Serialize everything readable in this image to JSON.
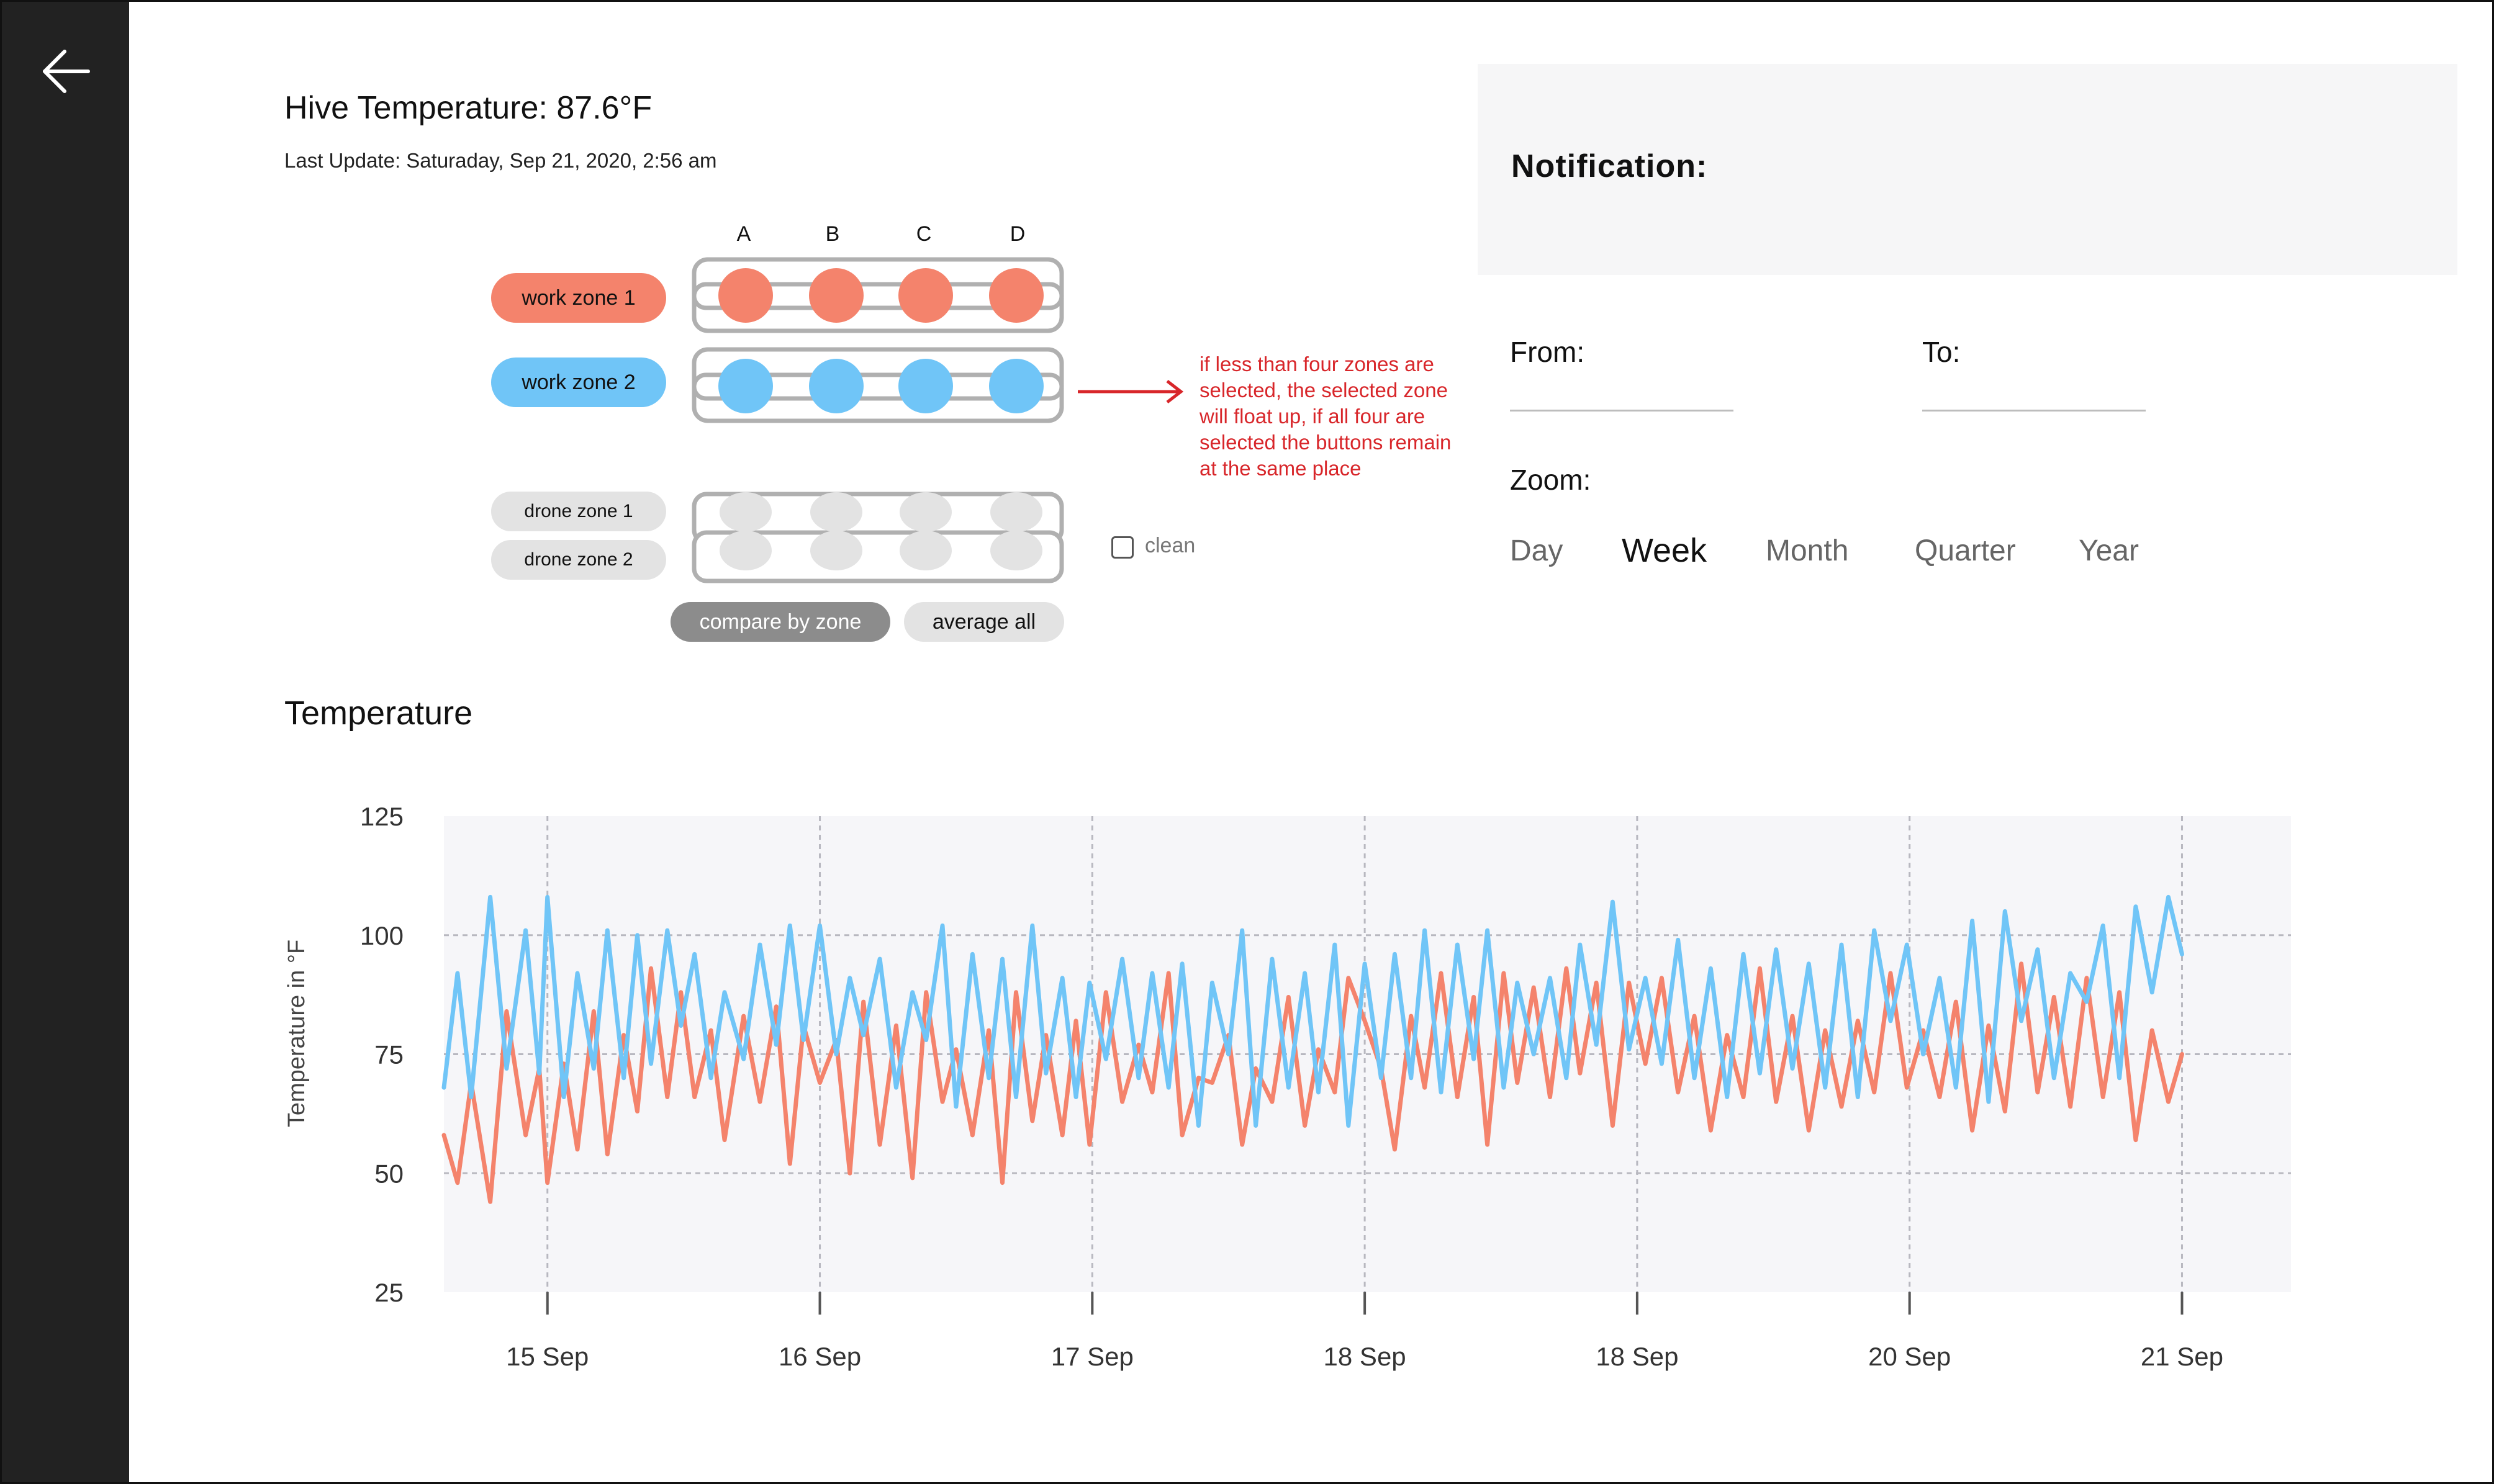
{
  "header": {
    "hive_temperature": "Hive Temperature: 87.6°F",
    "last_update": "Last Update: Saturaday, Sep 21, 2020, 2:56 am"
  },
  "zones": {
    "columns": [
      "A",
      "B",
      "C",
      "D"
    ],
    "work_zone_1": "work zone 1",
    "work_zone_2": "work zone 2",
    "drone_zone_1": "drone zone 1",
    "drone_zone_2": "drone zone 2",
    "compare_button": "compare by zone",
    "average_button": "average all",
    "clean_label": "clean",
    "annotation": "if less than four zones are selected, the selected zone will float up, if all four are selected the buttons remain at the same place"
  },
  "notification": {
    "title": "Notification:"
  },
  "filters": {
    "from_label": "From:",
    "to_label": "To:",
    "zoom_label": "Zoom:",
    "zoom_options": [
      "Day",
      "Week",
      "Month",
      "Quarter",
      "Year"
    ],
    "zoom_selected": "Week"
  },
  "chart_section": {
    "title": "Temperature"
  },
  "colors": {
    "work_zone_1": "#f4836c",
    "work_zone_2": "#70c5f7",
    "drone": "#e3e3e3",
    "annotation": "#d8262a",
    "sidebar": "#222222",
    "plot_background": "#f6f6f9"
  },
  "icons": {
    "back": "arrow-left-icon"
  },
  "chart_data": {
    "type": "line",
    "ylabel": "Temperature in °F",
    "ylim": [
      25,
      125
    ],
    "yticks": [
      25,
      50,
      75,
      100,
      125
    ],
    "x_tick_labels": [
      "15 Sep",
      "16 Sep",
      "17 Sep",
      "18 Sep",
      "18 Sep",
      "20 Sep",
      "21 Sep"
    ],
    "xlim": [
      14.62,
      21.4
    ],
    "x_tick_positions": [
      15,
      16,
      17,
      18,
      19,
      20,
      21
    ],
    "grid": true,
    "series": [
      {
        "color": "#f4836c",
        "x": [
          14.62,
          14.67,
          14.72,
          14.79,
          14.85,
          14.92,
          14.97,
          15.0,
          15.06,
          15.11,
          15.17,
          15.22,
          15.28,
          15.33,
          15.38,
          15.44,
          15.49,
          15.54,
          15.6,
          15.65,
          15.72,
          15.78,
          15.84,
          15.89,
          15.94,
          16.0,
          16.06,
          16.11,
          16.16,
          16.22,
          16.28,
          16.34,
          16.39,
          16.45,
          16.5,
          16.56,
          16.62,
          16.67,
          16.72,
          16.78,
          16.83,
          16.89,
          16.94,
          16.99,
          17.05,
          17.11,
          17.17,
          17.22,
          17.28,
          17.33,
          17.39,
          17.44,
          17.5,
          17.55,
          17.6,
          17.66,
          17.72,
          17.78,
          17.83,
          17.89,
          17.94,
          18.0,
          18.06,
          18.11,
          18.17,
          18.22,
          18.28,
          18.34,
          18.4,
          18.45,
          18.51,
          18.56,
          18.62,
          18.68,
          18.74,
          18.79,
          18.85,
          18.91,
          18.97,
          19.03,
          19.09,
          19.15,
          19.21,
          19.27,
          19.33,
          19.39,
          19.45,
          19.51,
          19.57,
          19.63,
          19.69,
          19.75,
          19.81,
          19.87,
          19.93,
          19.99,
          20.05,
          20.11,
          20.17,
          20.23,
          20.29,
          20.35,
          20.41,
          20.47,
          20.53,
          20.59,
          20.65,
          20.71,
          20.77,
          20.83,
          20.89,
          20.95,
          21.0
        ],
        "values": [
          58,
          48,
          69,
          44,
          84,
          58,
          72,
          48,
          73,
          55,
          84,
          54,
          79,
          63,
          93,
          66,
          88,
          66,
          80,
          57,
          83,
          65,
          85,
          52,
          81,
          69,
          78,
          50,
          86,
          56,
          81,
          49,
          88,
          65,
          76,
          58,
          80,
          48,
          88,
          61,
          79,
          58,
          82,
          56,
          88,
          65,
          77,
          67,
          92,
          58,
          70,
          69,
          79,
          56,
          72,
          65,
          87,
          60,
          76,
          67,
          91,
          82,
          72,
          55,
          83,
          68,
          92,
          66,
          87,
          56,
          92,
          69,
          89,
          66,
          93,
          71,
          90,
          60,
          90,
          73,
          91,
          67,
          83,
          59,
          79,
          66,
          93,
          65,
          83,
          59,
          80,
          64,
          82,
          67,
          92,
          68,
          80,
          66,
          86,
          59,
          81,
          63,
          94,
          67,
          87,
          64,
          91,
          66,
          88,
          57,
          80,
          65,
          75
        ]
      },
      {
        "color": "#70c5f7",
        "x": [
          14.62,
          14.67,
          14.72,
          14.79,
          14.85,
          14.92,
          14.97,
          15.0,
          15.06,
          15.11,
          15.17,
          15.22,
          15.28,
          15.33,
          15.38,
          15.44,
          15.49,
          15.54,
          15.6,
          15.65,
          15.72,
          15.78,
          15.84,
          15.89,
          15.94,
          16.0,
          16.06,
          16.11,
          16.16,
          16.22,
          16.28,
          16.34,
          16.39,
          16.45,
          16.5,
          16.56,
          16.62,
          16.67,
          16.72,
          16.78,
          16.83,
          16.89,
          16.94,
          16.99,
          17.05,
          17.11,
          17.17,
          17.22,
          17.28,
          17.33,
          17.39,
          17.44,
          17.5,
          17.55,
          17.6,
          17.66,
          17.72,
          17.78,
          17.83,
          17.89,
          17.94,
          18.0,
          18.06,
          18.11,
          18.17,
          18.22,
          18.28,
          18.34,
          18.4,
          18.45,
          18.51,
          18.56,
          18.62,
          18.68,
          18.74,
          18.79,
          18.85,
          18.91,
          18.97,
          19.03,
          19.09,
          19.15,
          19.21,
          19.27,
          19.33,
          19.39,
          19.45,
          19.51,
          19.57,
          19.63,
          19.69,
          19.75,
          19.81,
          19.87,
          19.93,
          19.99,
          20.05,
          20.11,
          20.17,
          20.23,
          20.29,
          20.35,
          20.41,
          20.47,
          20.53,
          20.59,
          20.65,
          20.71,
          20.77,
          20.83,
          20.89,
          20.95,
          21.0
        ],
        "values": [
          68,
          92,
          66,
          108,
          72,
          101,
          71,
          108,
          66,
          92,
          72,
          101,
          70,
          100,
          73,
          101,
          81,
          96,
          70,
          88,
          74,
          98,
          77,
          102,
          78,
          102,
          75,
          91,
          79,
          95,
          68,
          88,
          78,
          102,
          64,
          96,
          70,
          95,
          66,
          102,
          71,
          91,
          66,
          90,
          74,
          95,
          70,
          92,
          68,
          94,
          60,
          90,
          75,
          101,
          60,
          95,
          68,
          92,
          67,
          98,
          60,
          94,
          70,
          96,
          70,
          101,
          67,
          98,
          74,
          101,
          68,
          90,
          75,
          91,
          70,
          98,
          77,
          107,
          76,
          91,
          73,
          99,
          70,
          93,
          66,
          96,
          71,
          97,
          72,
          94,
          68,
          98,
          66,
          101,
          82,
          98,
          75,
          91,
          68,
          103,
          65,
          105,
          82,
          97,
          70,
          92,
          86,
          102,
          70,
          106,
          88,
          108,
          96
        ]
      }
    ]
  }
}
